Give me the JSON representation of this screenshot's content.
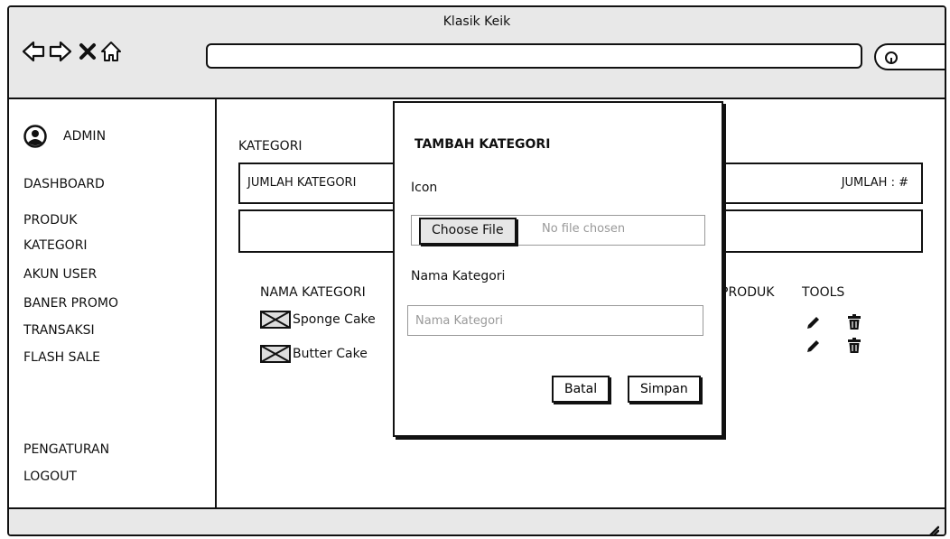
{
  "window": {
    "title": "Klasik Keik"
  },
  "icons": {
    "back": "arrow-left-icon",
    "forward": "arrow-right-icon",
    "close": "close-icon",
    "home": "home-icon",
    "search": "search-icon",
    "user": "user-circle-icon",
    "image": "image-placeholder-icon",
    "edit": "pencil-icon",
    "delete": "trash-icon",
    "resize": "resize-grip-icon"
  },
  "sidebar": {
    "user_label": "ADMIN",
    "items": [
      {
        "label": "DASHBOARD"
      },
      {
        "label": "PRODUK"
      },
      {
        "label": "KATEGORI"
      },
      {
        "label": "AKUN USER"
      },
      {
        "label": "BANER PROMO"
      },
      {
        "label": "TRANSAKSI"
      },
      {
        "label": "FLASH SALE"
      }
    ],
    "bottom_items": [
      {
        "label": "PENGATURAN"
      },
      {
        "label": "LOGOUT"
      }
    ]
  },
  "main": {
    "title": "KATEGORI",
    "summary": {
      "left": "JUMLAH KATEGORI",
      "right": "JUMLAH : #"
    },
    "columns": {
      "name": "NAMA KATEGORI",
      "produk": "PRODUK",
      "tools": "TOOLS"
    },
    "rows": [
      {
        "name": "Sponge Cake"
      },
      {
        "name": "Butter Cake"
      }
    ]
  },
  "modal": {
    "title": "TAMBAH KATEGORI",
    "icon_label": "Icon",
    "file_button": "Choose File",
    "file_status": "No file chosen",
    "name_label": "Nama Kategori",
    "name_placeholder": "Nama Kategori",
    "cancel_label": "Batal",
    "save_label": "Simpan"
  }
}
